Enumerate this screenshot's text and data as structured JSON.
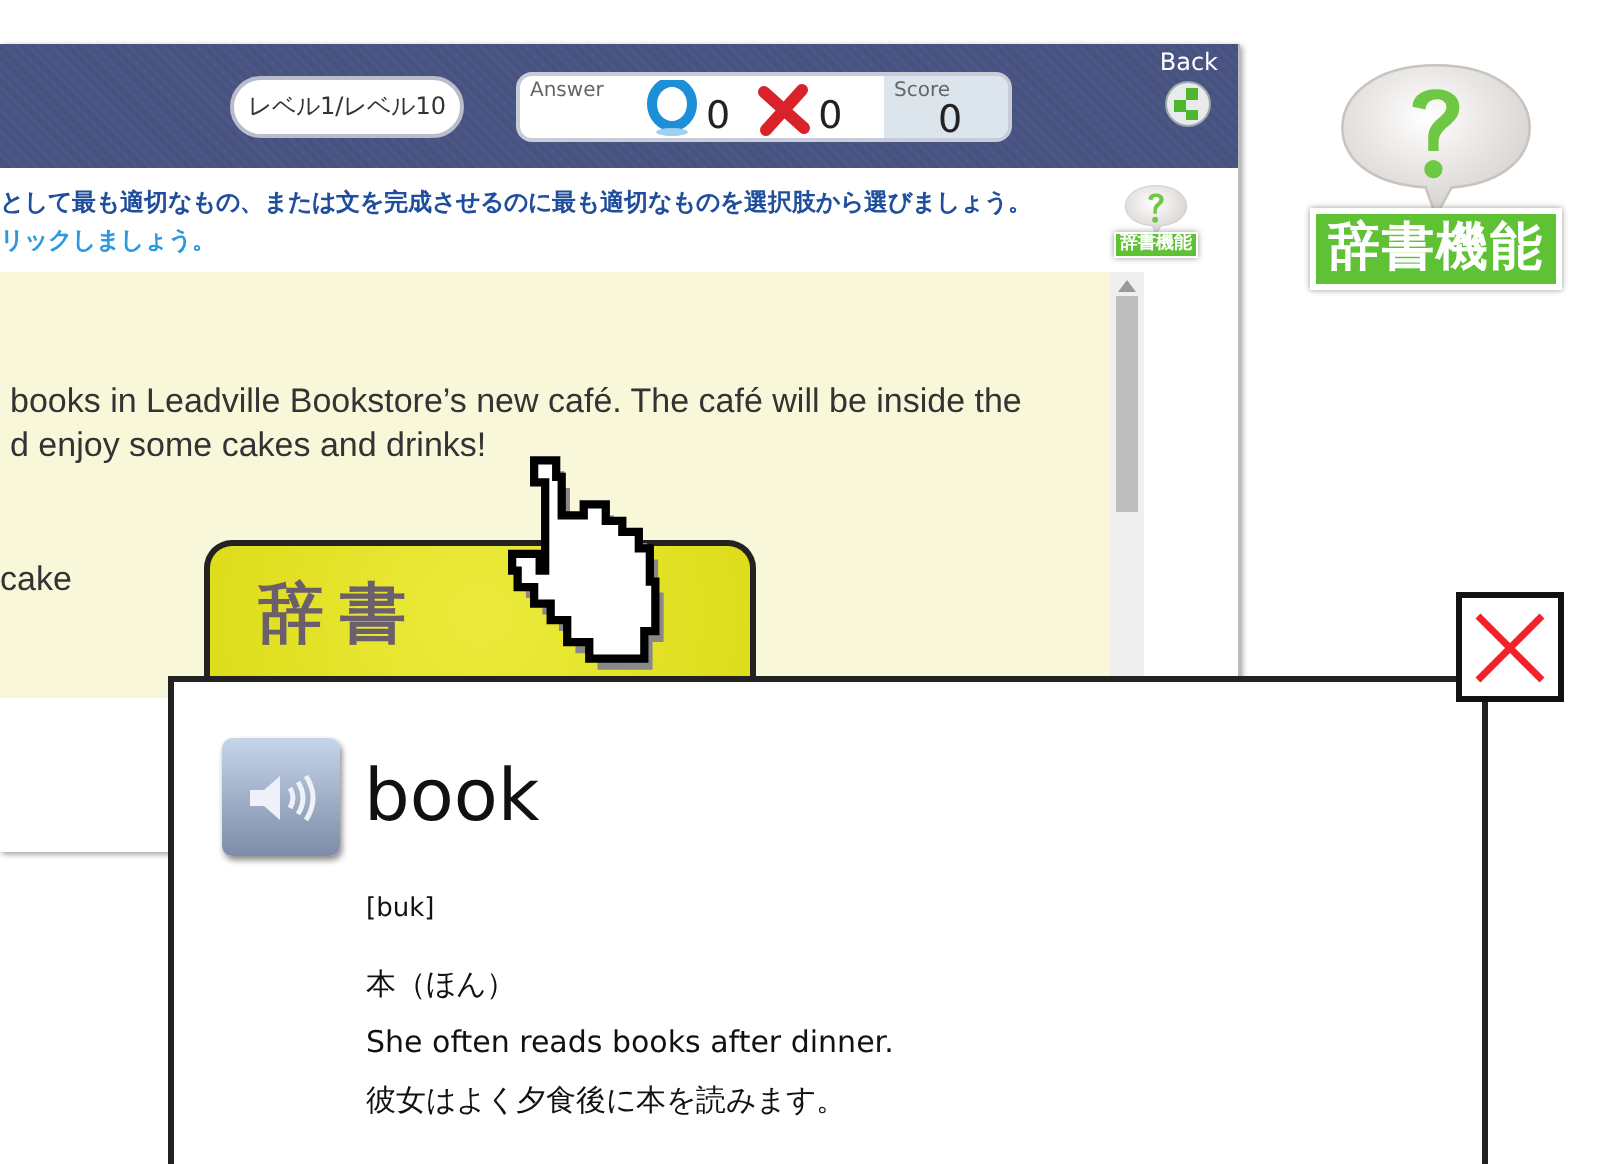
{
  "header": {
    "level": "レベル1/レベル10",
    "answer_label": "Answer",
    "correct_count": "0",
    "wrong_count": "0",
    "score_label": "Score",
    "score": "0",
    "back_label": "Back"
  },
  "instructions": [
    {
      "kind": "primary",
      "text": "として最も適切なもの、または文を完成させるのに最も適切なものを選択肢から選びましょう。"
    },
    {
      "kind": "secondary",
      "text": "リックしましょう。"
    }
  ],
  "help_button": {
    "label": "辞書機能"
  },
  "passage": {
    "lines": [
      "books in Leadville Bookstore’s new café. The café will be inside the",
      "d enjoy some cakes and drinks!"
    ],
    "choice": "cake"
  },
  "help_badge": {
    "label": "辞書機能"
  },
  "dictionary": {
    "tab_label": "辞書",
    "word": "book",
    "pronunciation": "[buk]",
    "meaning": "本（ほん）",
    "example": "She often reads books after dinner.",
    "example_translation": "彼女はよく夕食後に本を読みます。"
  }
}
